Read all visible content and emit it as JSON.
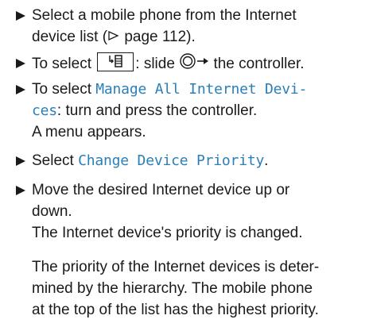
{
  "steps": [
    {
      "line1": "Select a mobile phone from the Internet",
      "line2": "device list (",
      "line2_ref": "page 112",
      "line2_end": ")."
    },
    {
      "pre": "To select ",
      "mid": ": slide ",
      "post": " the controller."
    },
    {
      "pre": "To select ",
      "highlight1": "Manage All Internet Devi-",
      "highlight2": "ces",
      "post": ": turn and press the controller.",
      "line3": "A menu appears."
    },
    {
      "pre": "Select ",
      "highlight": "Change Device Priority",
      "post": "."
    },
    {
      "line1": "Move the desired Internet device up or",
      "line2": "down.",
      "line3": "The Internet device's priority is changed."
    }
  ],
  "note": {
    "line1": "The priority of the Internet devices is deter-",
    "line2": "mined by the hierarchy. The mobile phone",
    "line3": "at the top of the list has the highest priority."
  },
  "icons": {
    "bullet": "triangle-bullet-icon",
    "reference": "reference-arrow-icon",
    "key": "phone-list-key-icon",
    "controller": "controller-slide-icon"
  },
  "colors": {
    "text": "#1a1a1a",
    "highlight": "#2a7fb8"
  }
}
